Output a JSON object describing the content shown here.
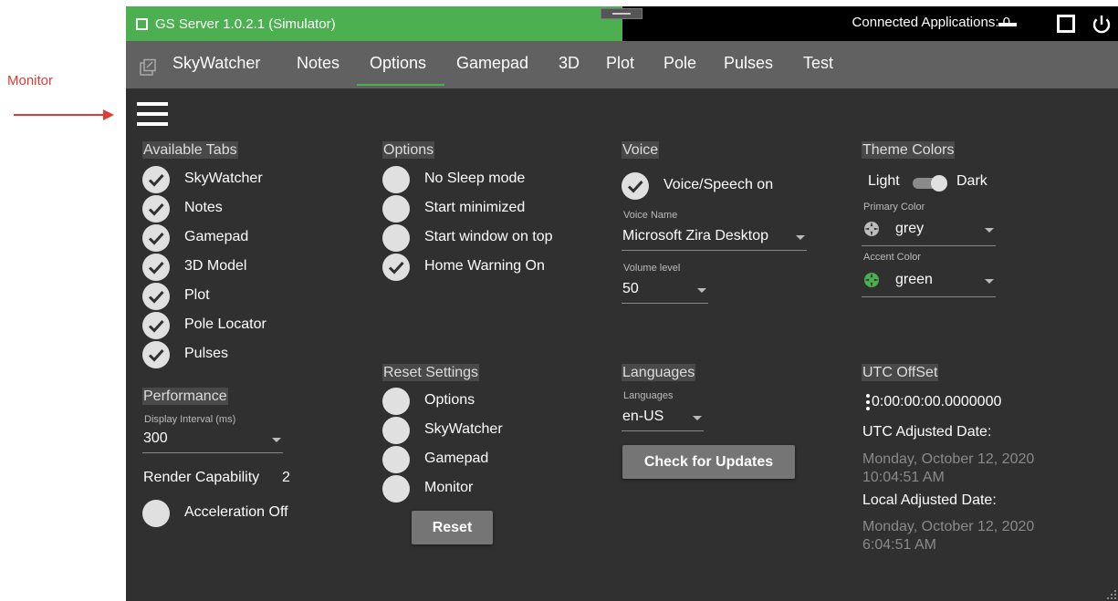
{
  "annotation": {
    "label": "Monitor",
    "arrow_color": "#e53935"
  },
  "window": {
    "title": "GS Server 1.0.2.1 (Simulator)",
    "connected": "Connected Applications: 0",
    "title_color": "#4caf50"
  },
  "tabs": [
    "SkyWatcher",
    "Notes",
    "Options",
    "Gamepad",
    "3D",
    "Plot",
    "Pole",
    "Pulses",
    "Test"
  ],
  "active_tab": "Options",
  "available_tabs": {
    "title": "Available Tabs",
    "items": [
      {
        "label": "SkyWatcher",
        "checked": true
      },
      {
        "label": "Notes",
        "checked": true
      },
      {
        "label": "Gamepad",
        "checked": true
      },
      {
        "label": "3D Model",
        "checked": true
      },
      {
        "label": "Plot",
        "checked": true
      },
      {
        "label": "Pole Locator",
        "checked": true
      },
      {
        "label": "Pulses",
        "checked": true
      }
    ]
  },
  "performance": {
    "title": "Performance",
    "interval_label": "Display Interval (ms)",
    "interval_value": "300",
    "render_capability_label": "Render Capability",
    "render_capability_value": "2",
    "acceleration": {
      "label": "Acceleration Off",
      "checked": false
    }
  },
  "options": {
    "title": "Options",
    "items": [
      {
        "label": "No Sleep mode",
        "checked": false
      },
      {
        "label": "Start minimized",
        "checked": false
      },
      {
        "label": "Start window on top",
        "checked": false
      },
      {
        "label": "Home Warning On",
        "checked": true
      }
    ]
  },
  "reset": {
    "title": "Reset Settings",
    "items": [
      {
        "label": "Options",
        "checked": false
      },
      {
        "label": "SkyWatcher",
        "checked": false
      },
      {
        "label": "Gamepad",
        "checked": false
      },
      {
        "label": "Monitor",
        "checked": false
      }
    ],
    "button": "Reset"
  },
  "voice": {
    "title": "Voice",
    "speech": {
      "label": "Voice/Speech on",
      "checked": true
    },
    "name_label": "Voice Name",
    "name_value": "Microsoft Zira Desktop",
    "volume_label": "Volume level",
    "volume_value": "50"
  },
  "languages": {
    "title": "Languages",
    "field_label": "Languages",
    "value": "en-US",
    "button": "Check for Updates"
  },
  "theme": {
    "title": "Theme Colors",
    "light_label": "Light",
    "dark_label": "Dark",
    "mode": "dark",
    "primary_label": "Primary Color",
    "primary_value": "grey",
    "primary_swatch": "#bdbdbd",
    "accent_label": "Accent Color",
    "accent_value": "green",
    "accent_swatch": "#4caf50"
  },
  "utc": {
    "title": "UTC OffSet",
    "offset": "0:00:00:00.0000000",
    "adjusted_label": "UTC Adjusted Date:",
    "adjusted_date": "Monday, October 12, 2020",
    "adjusted_time": "10:04:51 AM",
    "local_label": "Local Adjusted Date:",
    "local_date": "Monday, October 12, 2020",
    "local_time": "6:04:51 AM"
  }
}
